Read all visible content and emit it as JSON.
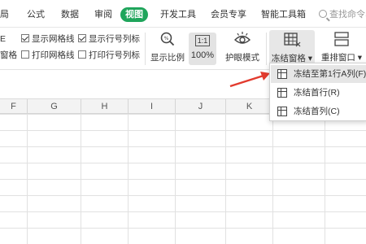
{
  "menubar": {
    "items": [
      {
        "label": "局"
      },
      {
        "label": "公式"
      },
      {
        "label": "数据"
      },
      {
        "label": "审阅"
      },
      {
        "label": "视图",
        "active": true
      },
      {
        "label": "开发工具"
      },
      {
        "label": "会员专享"
      },
      {
        "label": "智能工具箱"
      }
    ],
    "search_label": "查找命令、"
  },
  "ribbon": {
    "left_cut_1": "E",
    "left_cut_2": "窗格",
    "show_gridlines": "显示网格线",
    "show_headers": "显示行号列标",
    "print_gridlines": "打印网格线",
    "print_headers": "打印行号列标",
    "zoom_label": "显示比例",
    "ratio_icon": "1:1",
    "zoom_value": "100%",
    "eye_mode": "护眼模式",
    "freeze_panes": "冻结窗格",
    "rearrange": "重排窗口"
  },
  "freeze_menu": {
    "items": [
      {
        "label": "冻结至第1行A列(F)"
      },
      {
        "label": "冻结首行(R)"
      },
      {
        "label": "冻结首列(C)"
      }
    ]
  },
  "sheet": {
    "columns": [
      "F",
      "G",
      "H",
      "I",
      "J",
      "K"
    ]
  },
  "colors": {
    "active_tab": "#1fa55b",
    "arrow": "#e23b2e"
  },
  "icons": [
    "search-icon",
    "zoom-icon",
    "eye-icon",
    "freeze-panes-icon",
    "rearrange-window-icon",
    "checkbox"
  ]
}
